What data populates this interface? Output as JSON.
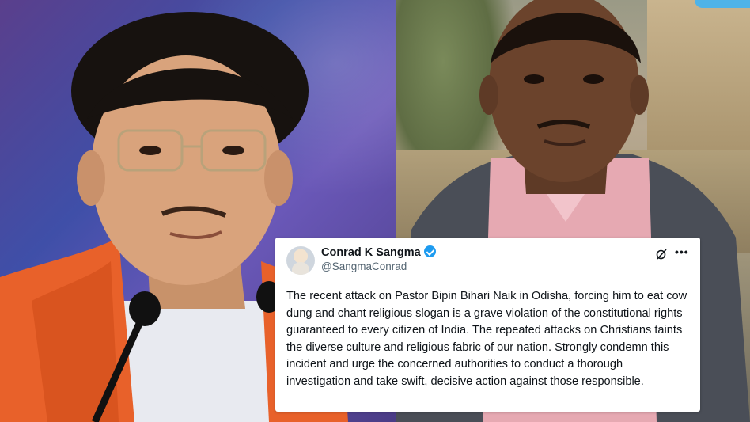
{
  "tweet": {
    "author_name": "Conrad K Sangma",
    "handle": "@SangmaConrad",
    "verified": true,
    "text": "The recent attack on Pastor Bipin Bihari Naik in Odisha, forcing him to eat cow dung and chant religious slogan is a grave violation of the constitutional rights guaranteed to every citizen of India. The repeated attacks on Christians taints the diverse culture and religious fabric of our nation. Strongly condemn this incident and urge the concerned authorities to conduct a thorough investigation and take swift, decisive action against those responsible."
  },
  "icons": {
    "grok": "grok-icon",
    "more": "more-options-icon",
    "verified": "verified-badge-icon"
  },
  "colors": {
    "verified_blue": "#1d9bf0",
    "text_primary": "#0f1419",
    "text_secondary": "#536471",
    "left_backdrop": "#4a3c86",
    "scarf_orange": "#e8612a"
  }
}
